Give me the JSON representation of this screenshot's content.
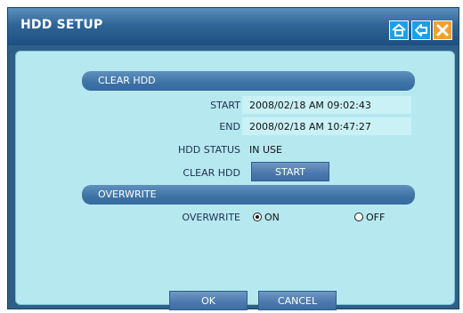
{
  "window": {
    "title": "HDD SETUP"
  },
  "clear_hdd": {
    "section_label": "CLEAR HDD",
    "start_label": "START",
    "start_value": "2008/02/18 AM 09:02:43",
    "end_label": "END",
    "end_value": "2008/02/18 AM 10:47:27",
    "status_label": "HDD STATUS",
    "status_value": "IN USE",
    "clear_label": "CLEAR HDD",
    "clear_button": "START"
  },
  "overwrite": {
    "section_label": "OVERWRITE",
    "label": "OVERWRITE",
    "options": [
      {
        "label": "ON",
        "selected": true
      },
      {
        "label": "OFF",
        "selected": false
      }
    ]
  },
  "footer": {
    "ok_button": "OK",
    "cancel_button": "CANCEL"
  },
  "colors": {
    "panel_bg": "#b6e8f0",
    "title_bar": "#2f6598",
    "section_bar": "#3e73a6",
    "home_icon_bg": "#1aa0e6",
    "close_icon_bg": "#f0a030"
  }
}
